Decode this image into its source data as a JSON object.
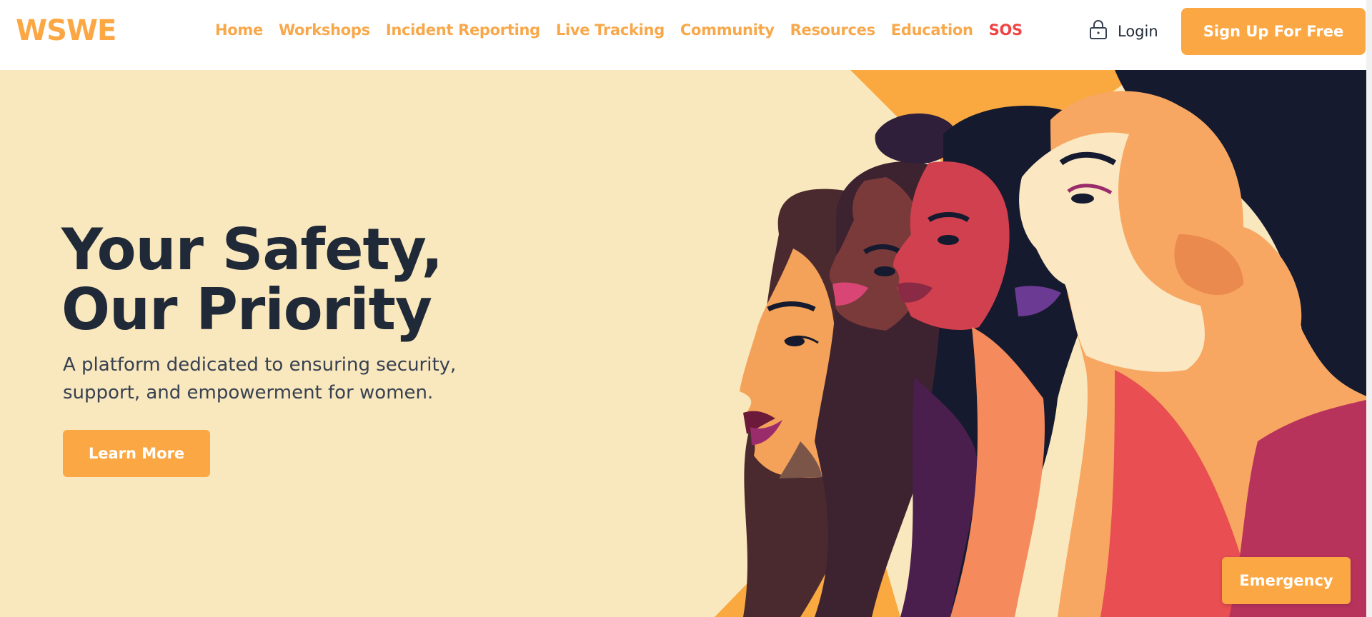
{
  "brand": {
    "logo": "WSWE",
    "accent": "#fba744",
    "sos_color": "#ef4444",
    "hero_bg": "#f9e7bd"
  },
  "nav": {
    "items": [
      {
        "label": "Home"
      },
      {
        "label": "Workshops"
      },
      {
        "label": "Incident Reporting"
      },
      {
        "label": "Live Tracking"
      },
      {
        "label": "Community"
      },
      {
        "label": "Resources"
      },
      {
        "label": "Education"
      },
      {
        "label": "SOS"
      }
    ]
  },
  "auth": {
    "login_label": "Login",
    "login_icon": "lock-icon",
    "signup_label": "Sign Up For Free"
  },
  "hero": {
    "title_line1": "Your Safety,",
    "title_line2": "Our Priority",
    "subtitle": "A platform dedicated to ensuring security, support, and empowerment for women.",
    "cta_label": "Learn More",
    "illustration": "women-profiles-illustration"
  },
  "floating": {
    "emergency_label": "Emergency"
  }
}
